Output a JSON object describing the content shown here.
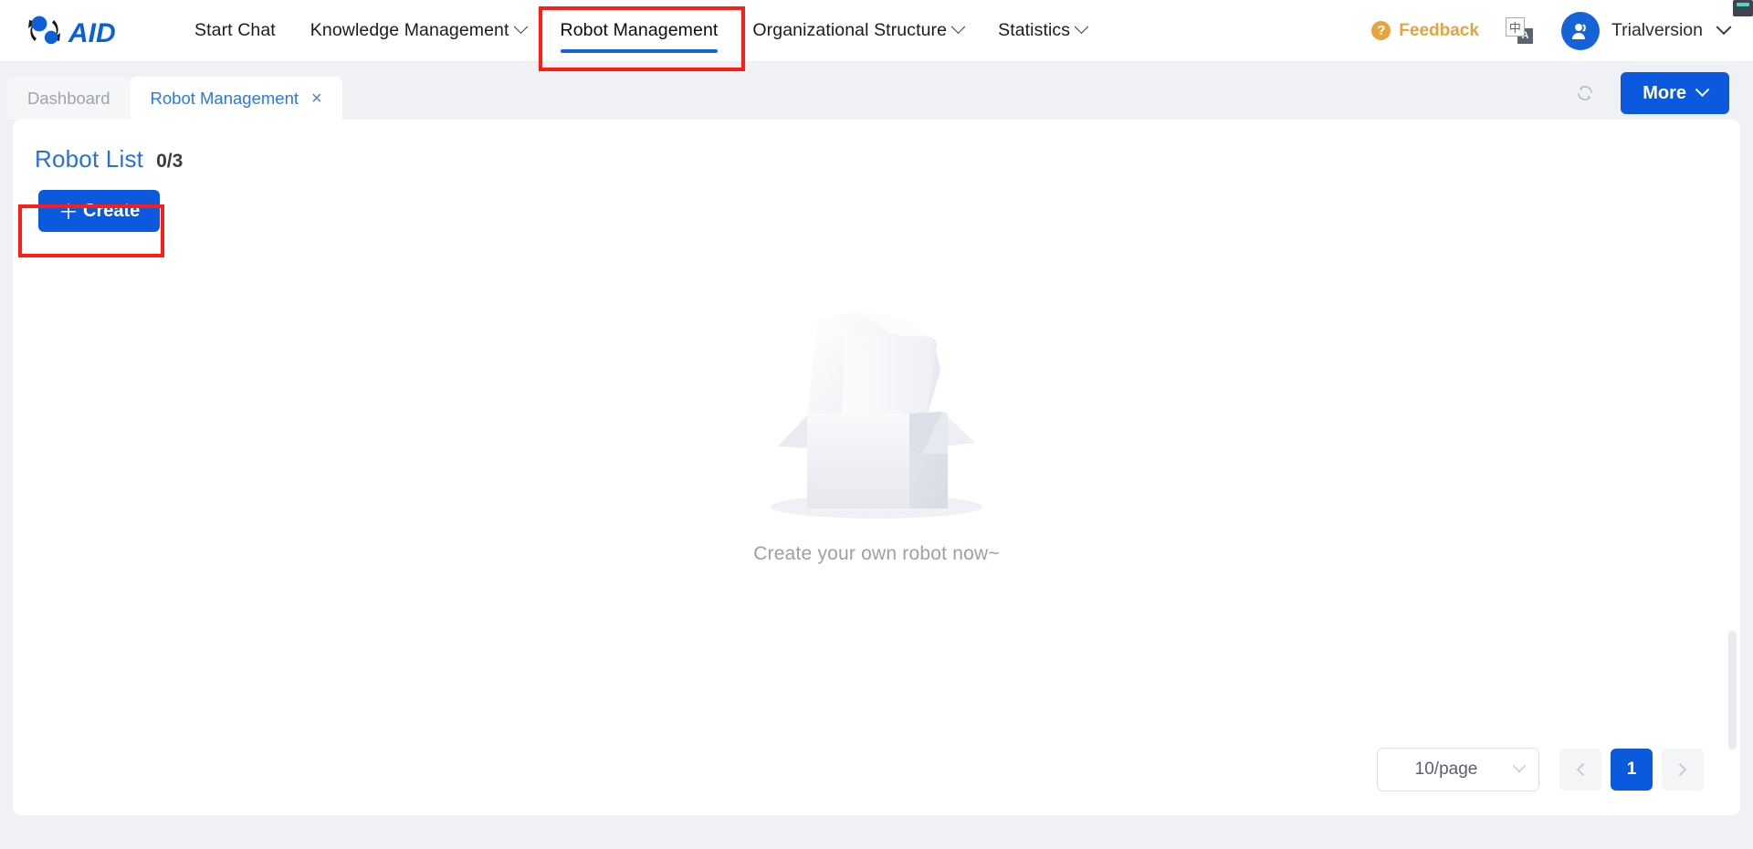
{
  "header": {
    "logo_text": "AID",
    "nav": [
      {
        "label": "Start Chat",
        "has_caret": false,
        "active": false
      },
      {
        "label": "Knowledge Management",
        "has_caret": true,
        "active": false
      },
      {
        "label": "Robot Management",
        "has_caret": false,
        "active": true
      },
      {
        "label": "Organizational Structure",
        "has_caret": true,
        "active": false
      },
      {
        "label": "Statistics",
        "has_caret": true,
        "active": false
      }
    ],
    "feedback_label": "Feedback",
    "translate_primary": "中",
    "translate_secondary": "A",
    "username": "Trialversion"
  },
  "tabbar": {
    "tabs": [
      {
        "label": "Dashboard",
        "active": false,
        "closable": false
      },
      {
        "label": "Robot Management",
        "active": true,
        "closable": true,
        "close_glyph": "×"
      }
    ],
    "refresh_icon": "refresh-icon",
    "more_label": "More"
  },
  "main": {
    "list_title": "Robot List",
    "list_count": "0/3",
    "create_label": "Create",
    "create_plus": "＋",
    "empty_text": "Create your own robot now~"
  },
  "pagination": {
    "page_size_label": "10/page",
    "prev_label": "prev-page",
    "next_label": "next-page",
    "pages": [
      "1"
    ],
    "current_page": "1"
  },
  "colors": {
    "brand_blue": "#0b59dd",
    "nav_active_blue": "#1464d8",
    "tab_active_blue": "#2878ec",
    "title_blue": "#2a6fe0",
    "feedback_orange": "#e8a33d",
    "annotation_red": "#fe1d12",
    "page_bg": "#f0f1f5",
    "empty_text_gray": "#9aa0ac"
  }
}
